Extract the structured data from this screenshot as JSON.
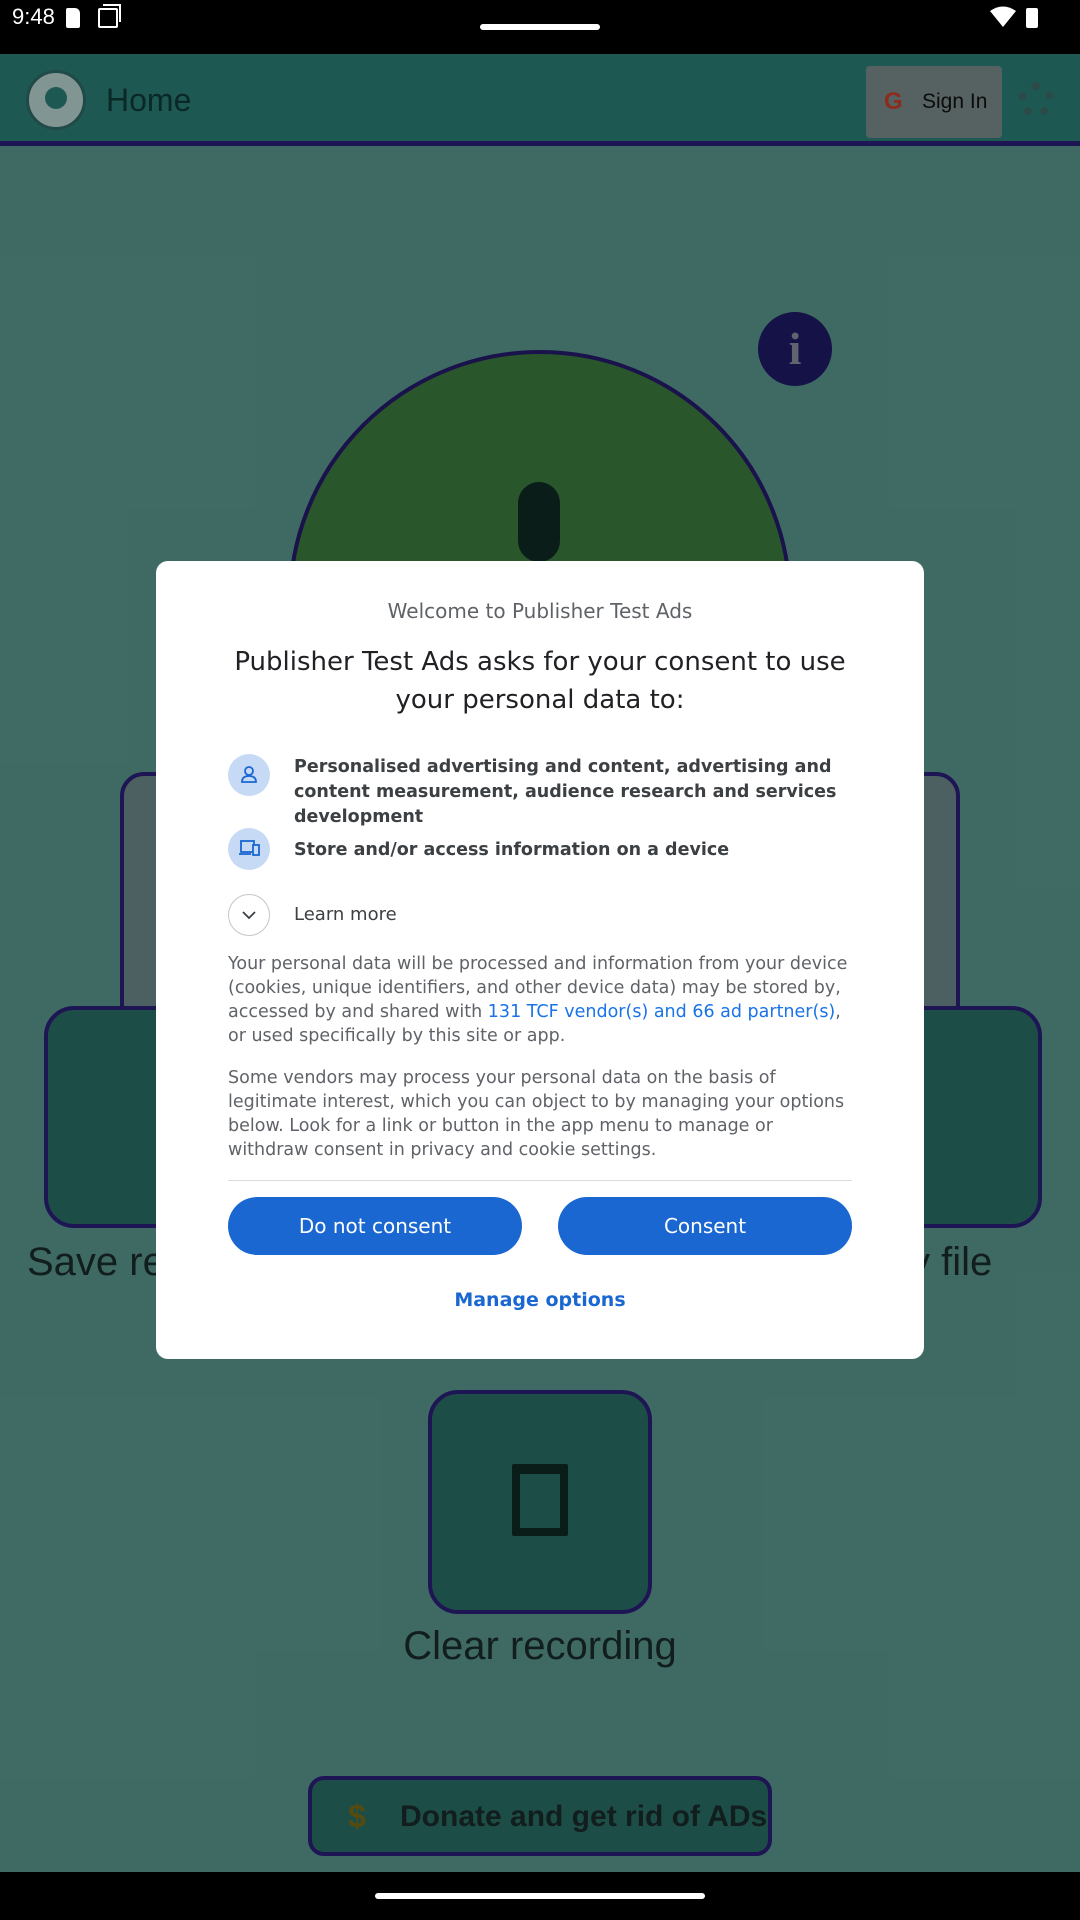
{
  "status_bar": {
    "time": "9:48"
  },
  "app": {
    "title": "Home",
    "sign_in_label": "Sign In",
    "google_glyph": "G",
    "info_glyph": "i",
    "save_label": "Save re",
    "file_label": "y file",
    "clear_label": "Clear recording",
    "donate_label": "Donate and get rid of ADs",
    "donate_glyph": "$"
  },
  "dialog": {
    "welcome": "Welcome to Publisher Test Ads",
    "heading": "Publisher Test Ads asks for your consent to use your personal data to:",
    "purposes": [
      {
        "label": "Personalised advertising and content, advertising and content measurement, audience research and services development",
        "icon": "person-icon"
      },
      {
        "label": "Store and/or access information on a device",
        "icon": "devices-icon"
      }
    ],
    "learn_more": "Learn more",
    "para1_before": "Your personal data will be processed and information from your device (cookies, unique identifiers, and other device data) may be stored by, accessed by and shared with ",
    "para1_link": "131 TCF vendor(s) and 66 ad partner(s)",
    "para1_after": ", or used specifically by this site or app.",
    "para2": "Some vendors may process your personal data on the basis of legitimate interest, which you can object to by managing your options below. Look for a link or button in the app menu to manage or withdraw consent in privacy and cookie settings.",
    "do_not_consent": "Do not consent",
    "consent": "Consent",
    "manage_options": "Manage options"
  },
  "colors": {
    "primary_button": "#1a67d2",
    "link": "#1a73e8",
    "icon_bg": "#c6daf6"
  }
}
